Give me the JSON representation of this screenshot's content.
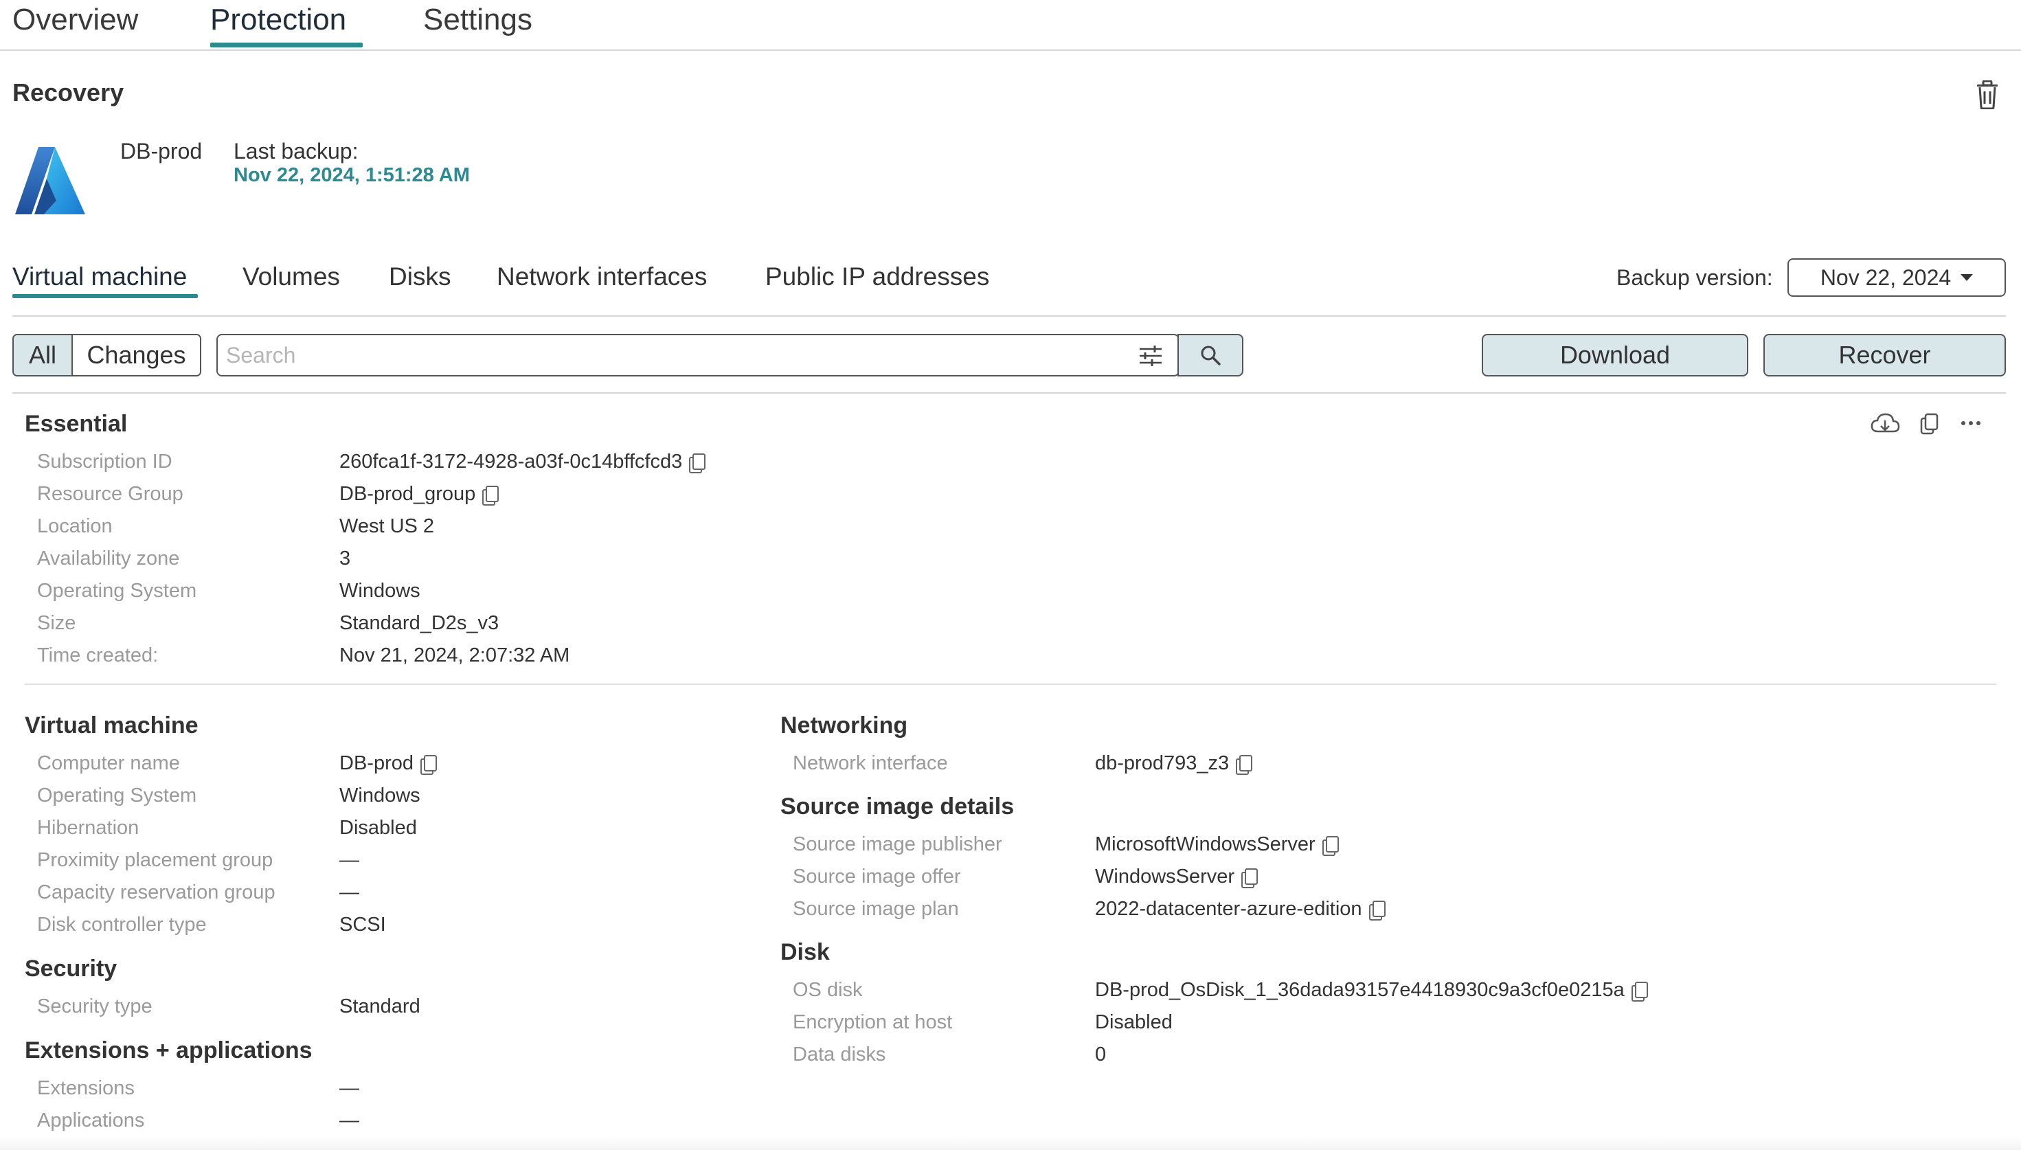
{
  "top_tabs": [
    {
      "label": "Overview"
    },
    {
      "label": "Protection",
      "active": true
    },
    {
      "label": "Settings"
    }
  ],
  "recovery": {
    "title": "Recovery",
    "vm_name": "DB-prod",
    "last_backup_label": "Last backup: ",
    "last_backup_value": "Nov 22, 2024, 1:51:28 AM",
    "logo_icon": "azure-logo",
    "delete_icon": "trash-icon"
  },
  "sub_tabs": [
    {
      "label": "Virtual machine",
      "active": true
    },
    {
      "label": "Volumes"
    },
    {
      "label": "Disks"
    },
    {
      "label": "Network interfaces"
    },
    {
      "label": "Public IP addresses"
    }
  ],
  "backup_version": {
    "label": "Backup version:",
    "value": "Nov 22, 2024"
  },
  "toolbar": {
    "all_label": "All",
    "changes_label": "Changes",
    "search_placeholder": "Search",
    "download_label": "Download",
    "recover_label": "Recover"
  },
  "essential": {
    "title": "Essential",
    "rows": [
      {
        "label": "Subscription ID",
        "value": "260fca1f-3172-4928-a03f-0c14bffcfcd3",
        "copy": true
      },
      {
        "label": "Resource Group",
        "value": "DB-prod_group",
        "copy": true
      },
      {
        "label": "Location",
        "value": "West US 2"
      },
      {
        "label": "Availability zone",
        "value": "3"
      },
      {
        "label": "Operating System",
        "value": "Windows"
      },
      {
        "label": "Size",
        "value": "Standard_D2s_v3"
      },
      {
        "label": "Time created:",
        "value": "Nov 21, 2024, 2:07:32 AM"
      }
    ]
  },
  "virtual_machine": {
    "title": "Virtual machine",
    "rows": [
      {
        "label": "Computer name",
        "value": "DB-prod",
        "copy": true
      },
      {
        "label": "Operating System",
        "value": "Windows"
      },
      {
        "label": "Hibernation",
        "value": "Disabled"
      },
      {
        "label": "Proximity placement group",
        "value": "—"
      },
      {
        "label": "Capacity reservation group",
        "value": "—"
      },
      {
        "label": "Disk controller type",
        "value": "SCSI"
      }
    ]
  },
  "security": {
    "title": "Security",
    "rows": [
      {
        "label": "Security type",
        "value": "Standard"
      }
    ]
  },
  "extensions": {
    "title": "Extensions + applications",
    "rows": [
      {
        "label": "Extensions",
        "value": "—"
      },
      {
        "label": "Applications",
        "value": "—"
      }
    ]
  },
  "networking": {
    "title": "Networking",
    "rows": [
      {
        "label": "Network interface",
        "value": "db-prod793_z3",
        "copy": true
      }
    ]
  },
  "source_image": {
    "title": "Source image details",
    "rows": [
      {
        "label": "Source image publisher",
        "value": "MicrosoftWindowsServer",
        "copy": true
      },
      {
        "label": "Source image offer",
        "value": "WindowsServer",
        "copy": true
      },
      {
        "label": "Source image plan",
        "value": "2022-datacenter-azure-edition",
        "copy": true
      }
    ]
  },
  "disk": {
    "title": "Disk",
    "rows": [
      {
        "label": "OS disk",
        "value": "DB-prod_OsDisk_1_36dada93157e4418930c9a3cf0e0215a",
        "copy": true
      },
      {
        "label": "Encryption at host",
        "value": "Disabled"
      },
      {
        "label": "Data disks",
        "value": "0"
      }
    ]
  },
  "colors": {
    "accent": "#2b8a92",
    "button_bg": "#d9e7ea"
  }
}
